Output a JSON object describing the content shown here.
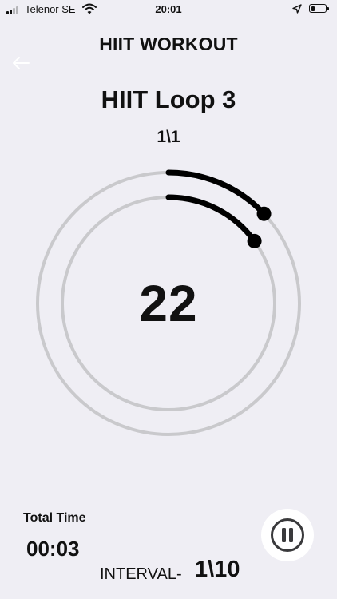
{
  "status_bar": {
    "carrier": "Telenor SE",
    "time": "20:01",
    "signal_bars": 2,
    "signal_bars_total": 4,
    "battery_level": 0.25
  },
  "header": {
    "title": "HIIT WORKOUT",
    "back_icon": "arrow-left-icon"
  },
  "workout": {
    "name": "HIIT Loop 3",
    "round": "1\\1",
    "countdown": "22",
    "outer_progress": 0.13,
    "inner_progress": 0.15,
    "track_color": "#c9c9cc",
    "progress_color": "#000000"
  },
  "footer": {
    "total_time_label": "Total Time",
    "total_time_value": "00:03",
    "interval_label": "INTERVAL-",
    "interval_value": "1\\10",
    "pause_icon": "pause-icon"
  }
}
